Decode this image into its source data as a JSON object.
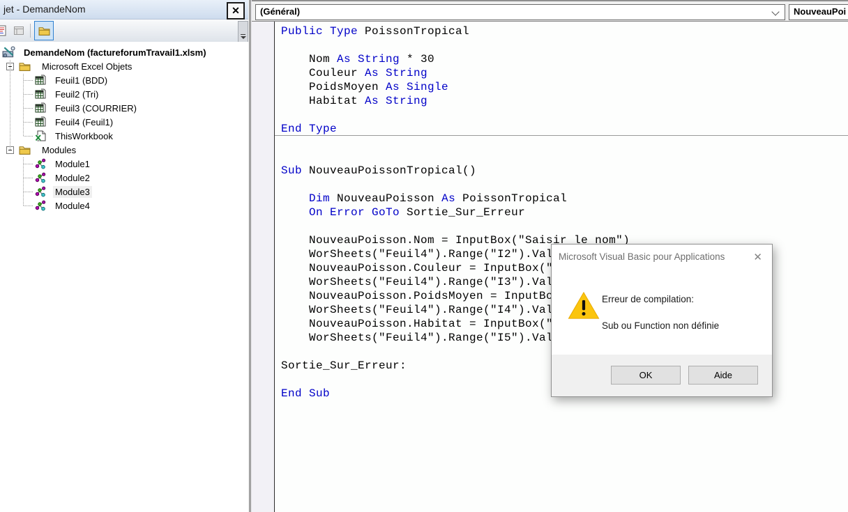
{
  "project_panel": {
    "title": "jet - DemandeNom",
    "close_icon": "✕",
    "tree": {
      "root_label": "DemandeNom (factureforumTravail1.xlsm)",
      "items": [
        {
          "label": "Microsoft Excel Objets",
          "level": 1,
          "icon": "folder-icon",
          "expander": "minus"
        },
        {
          "label": "Feuil1 (BDD)",
          "level": 2,
          "icon": "worksheet-icon"
        },
        {
          "label": "Feuil2 (Tri)",
          "level": 2,
          "icon": "worksheet-icon"
        },
        {
          "label": "Feuil3 (COURRIER)",
          "level": 2,
          "icon": "worksheet-icon"
        },
        {
          "label": "Feuil4 (Feuil1)",
          "level": 2,
          "icon": "worksheet-icon"
        },
        {
          "label": "ThisWorkbook",
          "level": 2,
          "icon": "workbook-icon"
        },
        {
          "label": "Modules",
          "level": 1,
          "icon": "folder-icon",
          "expander": "minus"
        },
        {
          "label": "Module1",
          "level": 2,
          "icon": "module-icon"
        },
        {
          "label": "Module2",
          "level": 2,
          "icon": "module-icon"
        },
        {
          "label": "Module3",
          "level": 2,
          "icon": "module-icon",
          "selected": true
        },
        {
          "label": "Module4",
          "level": 2,
          "icon": "module-icon"
        }
      ]
    }
  },
  "code_window": {
    "object_dropdown_value": "(Général)",
    "procedure_dropdown_value": "NouveauPoi",
    "colors": {
      "keyword": "#0000C8",
      "normal": "#000000"
    },
    "lines": [
      {
        "segs": [
          [
            "k",
            "Public Type"
          ],
          [
            "n",
            " PoissonTropical"
          ]
        ]
      },
      {
        "segs": []
      },
      {
        "segs": [
          [
            "n",
            "    Nom "
          ],
          [
            "k",
            "As String"
          ],
          [
            "n",
            " * 30"
          ]
        ]
      },
      {
        "segs": [
          [
            "n",
            "    Couleur "
          ],
          [
            "k",
            "As String"
          ]
        ]
      },
      {
        "segs": [
          [
            "n",
            "    PoidsMoyen "
          ],
          [
            "k",
            "As Single"
          ]
        ]
      },
      {
        "segs": [
          [
            "n",
            "    Habitat "
          ],
          [
            "k",
            "As String"
          ]
        ]
      },
      {
        "segs": []
      },
      {
        "segs": [
          [
            "k",
            "End Type"
          ]
        ],
        "separator_after": true
      },
      {
        "segs": []
      },
      {
        "segs": []
      },
      {
        "segs": [
          [
            "k",
            "Sub"
          ],
          [
            "n",
            " NouveauPoissonTropical()"
          ]
        ]
      },
      {
        "segs": []
      },
      {
        "segs": [
          [
            "n",
            "    "
          ],
          [
            "k",
            "Dim"
          ],
          [
            "n",
            " NouveauPoisson "
          ],
          [
            "k",
            "As"
          ],
          [
            "n",
            " PoissonTropical"
          ]
        ]
      },
      {
        "segs": [
          [
            "n",
            "    "
          ],
          [
            "k",
            "On Error GoTo"
          ],
          [
            "n",
            " Sortie_Sur_Erreur"
          ]
        ]
      },
      {
        "segs": []
      },
      {
        "segs": [
          [
            "n",
            "    NouveauPoisson.Nom = InputBox(\"Saisir le nom\")"
          ]
        ]
      },
      {
        "segs": [
          [
            "n",
            "    WorSheets(\"Feuil4\").Range(\"I2\").Val"
          ]
        ]
      },
      {
        "segs": [
          [
            "n",
            "    NouveauPoisson.Couleur = InputBox(\""
          ]
        ]
      },
      {
        "segs": [
          [
            "n",
            "    WorSheets(\"Feuil4\").Range(\"I3\").Val"
          ]
        ]
      },
      {
        "segs": [
          [
            "n",
            "    NouveauPoisson.PoidsMoyen = InputBo"
          ]
        ]
      },
      {
        "segs": [
          [
            "n",
            "    WorSheets(\"Feuil4\").Range(\"I4\").Val"
          ]
        ]
      },
      {
        "segs": [
          [
            "n",
            "    NouveauPoisson.Habitat = InputBox(\""
          ]
        ]
      },
      {
        "segs": [
          [
            "n",
            "    WorSheets(\"Feuil4\").Range(\"I5\").Val"
          ]
        ]
      },
      {
        "segs": []
      },
      {
        "segs": [
          [
            "n",
            "Sortie_Sur_Erreur:"
          ]
        ]
      },
      {
        "segs": []
      },
      {
        "segs": [
          [
            "k",
            "End Sub"
          ]
        ]
      }
    ]
  },
  "dialog": {
    "title": "Microsoft Visual Basic pour Applications",
    "close_icon": "✕",
    "warning_color": "#FBC50E",
    "message_line1": "Erreur de compilation:",
    "message_line2": "Sub ou Function non définie",
    "ok_button": "OK",
    "help_button": "Aide"
  }
}
